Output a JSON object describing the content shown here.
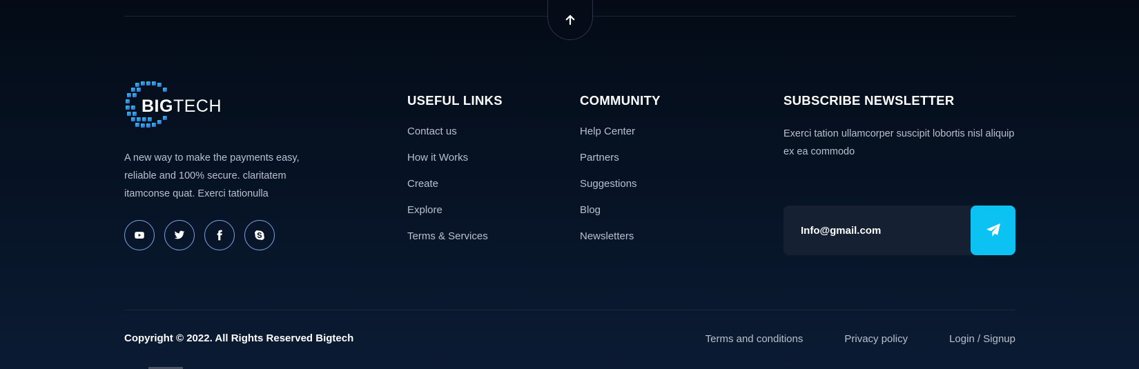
{
  "brand": {
    "logo_bold": "BIG",
    "logo_light": "TECH",
    "about": "A new way to make the payments easy, reliable and 100% secure. claritatem itamconse quat. Exerci tationulla"
  },
  "socials": [
    {
      "name": "youtube-icon"
    },
    {
      "name": "twitter-icon"
    },
    {
      "name": "facebook-icon"
    },
    {
      "name": "skype-icon"
    }
  ],
  "useful_links": {
    "title": "USEFUL LINKS",
    "items": [
      "Contact us",
      "How it Works",
      "Create",
      "Explore",
      "Terms & Services"
    ]
  },
  "community": {
    "title": "COMMUNITY",
    "items": [
      "Help Center",
      "Partners",
      "Suggestions",
      "Blog",
      "Newsletters"
    ]
  },
  "newsletter": {
    "title": "SUBSCRIBE NEWSLETTER",
    "text": "Exerci tation ullamcorper suscipit lobortis nisl aliquip ex ea commodo",
    "input_placeholder": "Info@gmail.com",
    "send_icon": "paper-plane-icon"
  },
  "footer": {
    "copyright": "Copyright © 2022. All Rights Reserved Bigtech",
    "links": [
      "Terms and conditions",
      "Privacy policy",
      "Login / Signup"
    ]
  },
  "colors": {
    "accent": "#0bc2f2",
    "social_border": "#7fa2e6",
    "background": "#061223"
  }
}
